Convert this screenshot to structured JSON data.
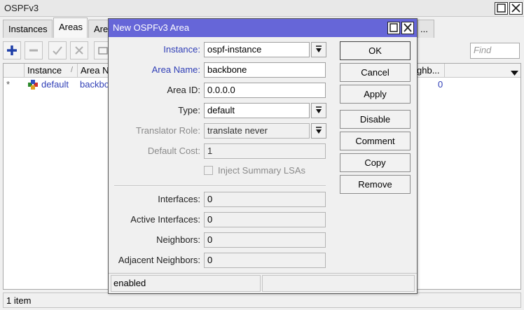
{
  "main_window": {
    "title": "OSPFv3",
    "tabs": [
      {
        "label": "Instances"
      },
      {
        "label": "Areas"
      },
      {
        "label": "Are"
      },
      {
        "label": "..."
      }
    ],
    "find_placeholder": "Find",
    "table": {
      "columns": [
        "Instance",
        "Area N",
        "ghb..."
      ],
      "sort_indicator": "/",
      "rows": [
        {
          "flag": "*",
          "instance": "default",
          "area_name": "backbo",
          "neighbors": "0"
        }
      ]
    },
    "status": "1 item"
  },
  "dialog": {
    "title": "New OSPFv3 Area",
    "fields": {
      "instance": {
        "label": "Instance:",
        "value": "ospf-instance"
      },
      "area_name": {
        "label": "Area Name:",
        "value": "backbone"
      },
      "area_id": {
        "label": "Area ID:",
        "value": "0.0.0.0"
      },
      "type": {
        "label": "Type:",
        "value": "default"
      },
      "translator_role": {
        "label": "Translator Role:",
        "value": "translate never"
      },
      "default_cost": {
        "label": "Default Cost:",
        "value": "1"
      },
      "inject_summary": {
        "label": "Inject Summary LSAs",
        "checked": false
      },
      "interfaces": {
        "label": "Interfaces:",
        "value": "0"
      },
      "active_interfaces": {
        "label": "Active Interfaces:",
        "value": "0"
      },
      "neighbors": {
        "label": "Neighbors:",
        "value": "0"
      },
      "adjacent_neighbors": {
        "label": "Adjacent Neighbors:",
        "value": "0"
      }
    },
    "buttons": {
      "ok": "OK",
      "cancel": "Cancel",
      "apply": "Apply",
      "disable": "Disable",
      "comment": "Comment",
      "copy": "Copy",
      "remove": "Remove"
    },
    "status": "enabled"
  },
  "colors": {
    "dialog_title_bg": "#6666d8",
    "label_blue": "#2f3eb6",
    "link_blue": "#2f3eb6",
    "add_icon_blue": "#1f3fa8"
  },
  "icons": [
    "maximize-icon",
    "close-icon",
    "add-icon",
    "remove-icon",
    "enable-icon",
    "disable-icon",
    "comment-icon",
    "dropdown-arrow-icon",
    "area-icon"
  ]
}
